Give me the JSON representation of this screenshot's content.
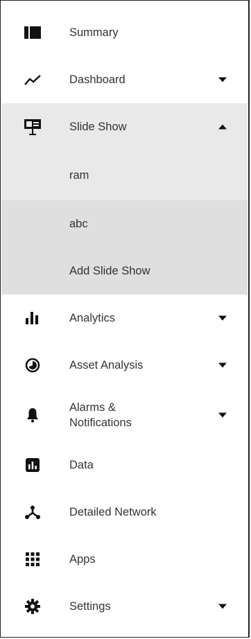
{
  "sidebar": {
    "items": [
      {
        "label": "Summary",
        "icon": "summary-icon"
      },
      {
        "label": "Dashboard",
        "icon": "trend-line-icon",
        "expandable": true
      },
      {
        "label": "Slide Show",
        "icon": "presentation-icon",
        "expandable": true,
        "expanded": true,
        "children": [
          "ram",
          "abc",
          "Add Slide Show"
        ]
      },
      {
        "label": "Analytics",
        "icon": "bar-chart-icon",
        "expandable": true
      },
      {
        "label": "Asset Analysis",
        "icon": "pie-chart-icon",
        "expandable": true
      },
      {
        "label": "Alarms & Notifications",
        "label_line1": "Alarms &",
        "label_line2": "Notifications",
        "icon": "bell-icon",
        "expandable": true
      },
      {
        "label": "Data",
        "icon": "data-icon"
      },
      {
        "label": "Detailed Network",
        "icon": "network-icon"
      },
      {
        "label": "Apps",
        "icon": "apps-grid-icon"
      },
      {
        "label": "Settings",
        "icon": "gear-icon",
        "expandable": true
      }
    ]
  },
  "colors": {
    "active_bg": "#e9e9e9",
    "add_bg": "#dfdfdf",
    "icon": "#111111",
    "text": "#333333"
  }
}
